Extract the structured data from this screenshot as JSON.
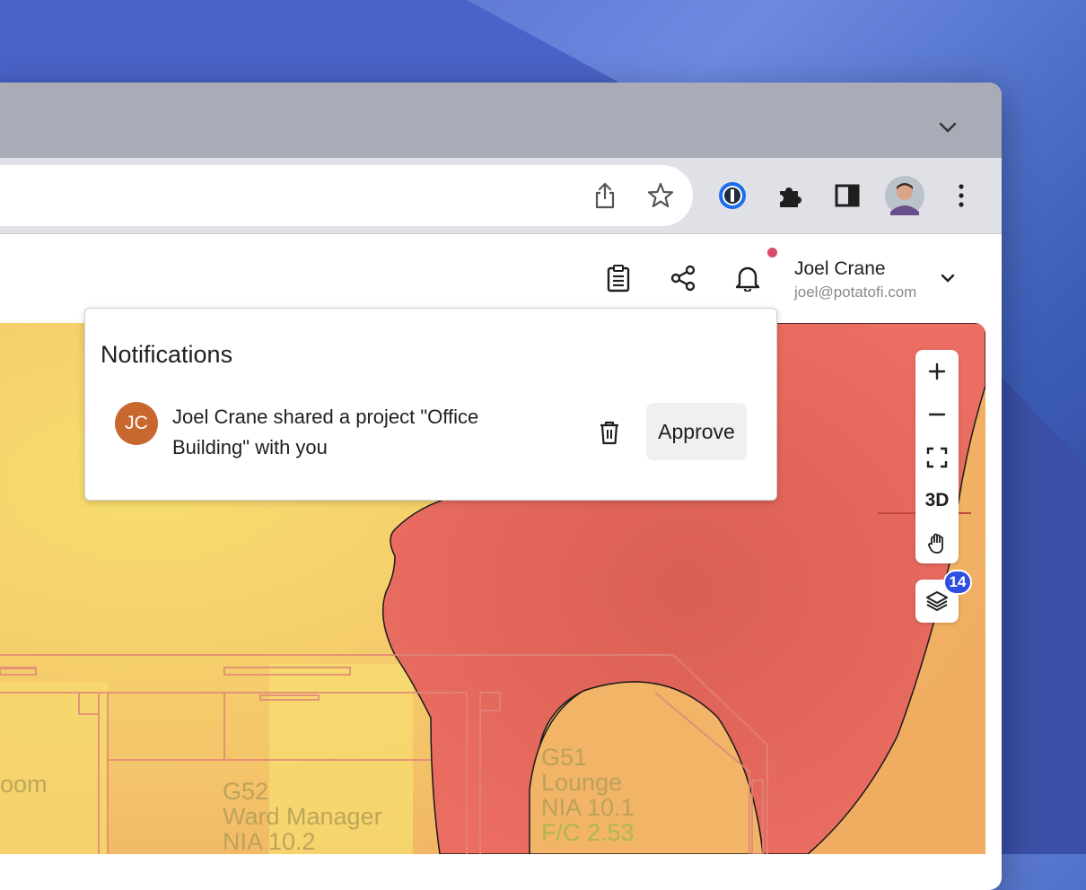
{
  "header": {
    "user_name": "Joel Crane",
    "user_email": "joel@potatofi.com"
  },
  "notifications": {
    "title": "Notifications",
    "items": [
      {
        "avatar_initials": "JC",
        "message": "Joel Crane shared a project \"Office Building\" with you",
        "action_label": "Approve"
      }
    ]
  },
  "map_controls": {
    "three_d_label": "3D",
    "layers_badge": "14"
  },
  "floorplan_rooms": [
    {
      "fragment": "oom"
    },
    {
      "code": "G52",
      "name": "Ward Manager",
      "nia": "NIA 10.2"
    },
    {
      "code": "G51",
      "name": "Lounge",
      "nia": "NIA 10.1",
      "fc": "F/C  2.53"
    }
  ],
  "colors": {
    "heatmap_red": "#e8665c",
    "heatmap_orange": "#f2b467",
    "heatmap_yellow": "#f7de6e",
    "accent_blue": "#2f4fe0",
    "avatar_orange": "#c9682e"
  }
}
